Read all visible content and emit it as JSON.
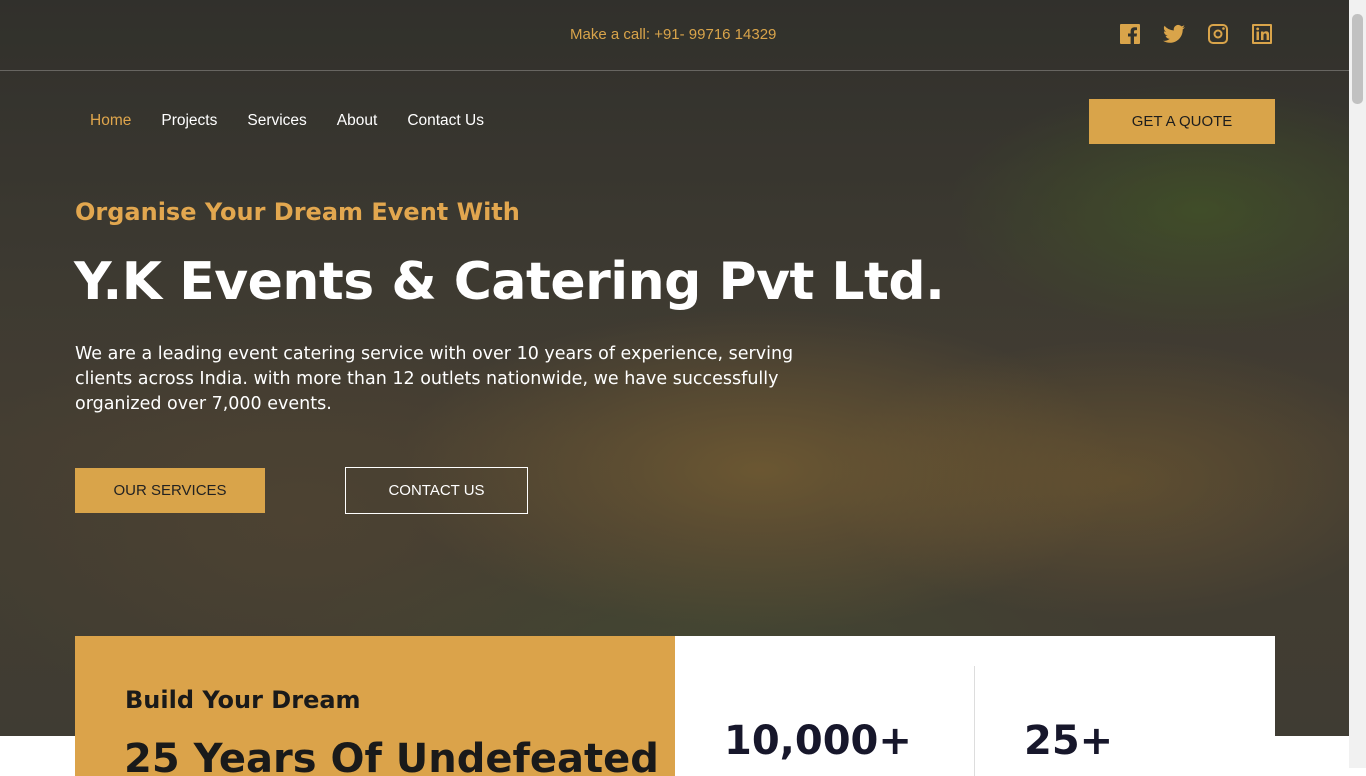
{
  "topbar": {
    "call_text": "Make a call: +91- 99716 14329",
    "socials": [
      "facebook-icon",
      "twitter-icon",
      "instagram-icon",
      "linkedin-icon"
    ]
  },
  "nav": {
    "items": [
      {
        "label": "Home",
        "active": true
      },
      {
        "label": "Projects"
      },
      {
        "label": "Services"
      },
      {
        "label": "About"
      },
      {
        "label": "Contact Us"
      }
    ],
    "quote_label": "GET A QUOTE"
  },
  "hero": {
    "kicker": "Organise Your Dream Event With",
    "headline": "Y.K Events & Catering Pvt Ltd.",
    "description": "We are a leading event catering service with over 10 years of experience, serving clients across India. with more than 12 outlets nationwide, we have successfully organized over 7,000 events.",
    "services_label": "OUR SERVICES",
    "contact_label": "CONTACT US"
  },
  "stats_section": {
    "subtitle": "Build Your Dream",
    "title": "25 Years Of Undefeated",
    "stat1": "10,000+",
    "stat2": "25+"
  },
  "colors": {
    "accent": "#d9a44a",
    "dark_text": "#17172b"
  }
}
